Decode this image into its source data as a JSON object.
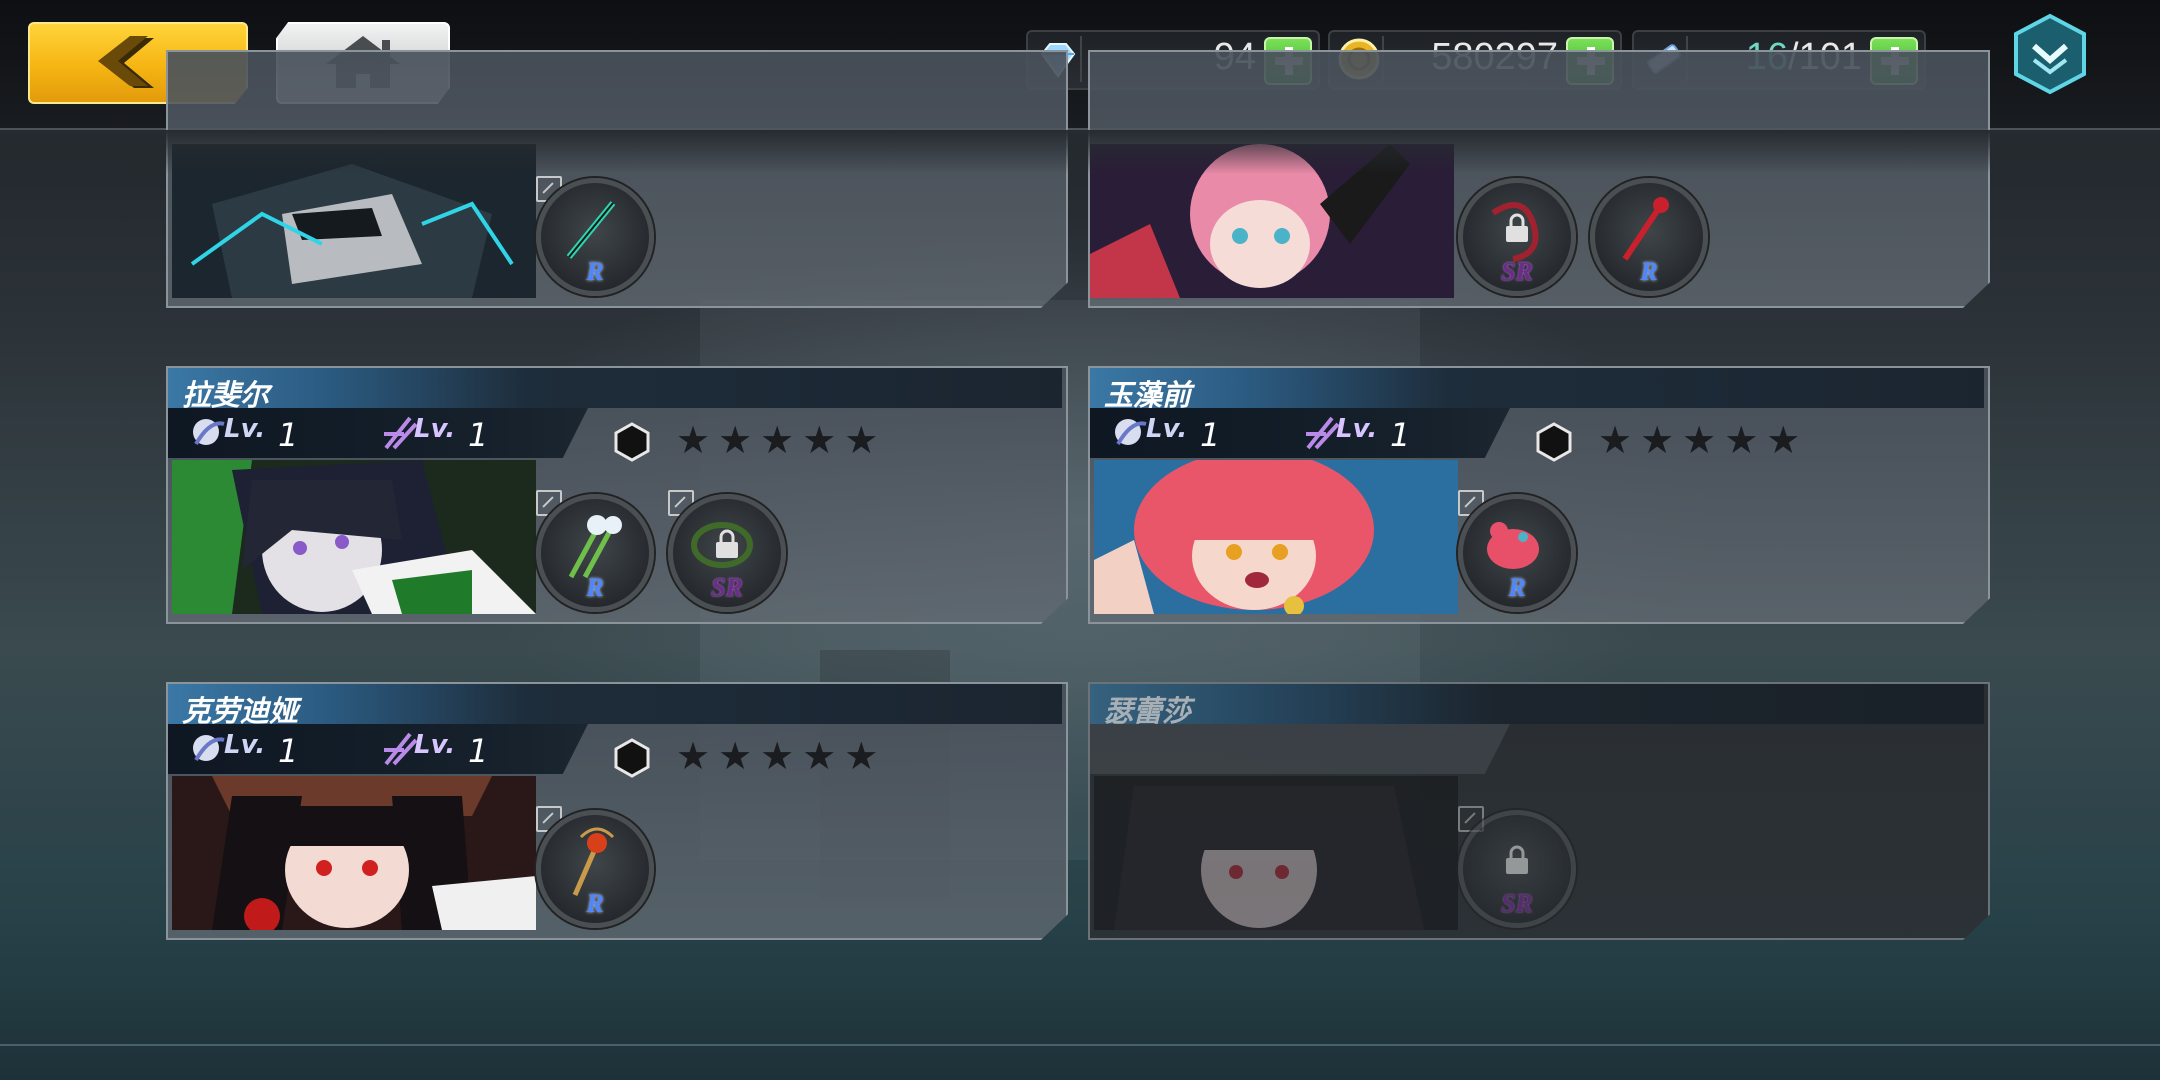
{
  "header": {
    "back_label": "",
    "home_label": "",
    "resources": [
      {
        "icon": "diamond-icon",
        "value": "94"
      },
      {
        "icon": "gold-coin-icon",
        "value": "580297"
      },
      {
        "icon": "stamina-ticket-icon",
        "current": "16",
        "max": "/101"
      }
    ]
  },
  "cards": [
    {
      "name": "",
      "level_skill": "",
      "level_weapon": "",
      "stars": "",
      "equipment": [
        {
          "rarity": "R",
          "locked": false
        }
      ]
    },
    {
      "name": "",
      "level_skill": "",
      "level_weapon": "",
      "stars": "",
      "equipment": [
        {
          "rarity": "SR",
          "locked": true
        },
        {
          "rarity": "R",
          "locked": false
        }
      ]
    },
    {
      "name": "拉斐尔",
      "lv_label": "Lv.",
      "level_skill": "1",
      "level_weapon": "1",
      "stars": "★★★★★",
      "equipment": [
        {
          "rarity": "R",
          "locked": false
        },
        {
          "rarity": "SR",
          "locked": true
        }
      ]
    },
    {
      "name": "玉藻前",
      "lv_label": "Lv.",
      "level_skill": "1",
      "level_weapon": "1",
      "stars": "★★★★★",
      "equipment": [
        {
          "rarity": "R",
          "locked": false
        }
      ]
    },
    {
      "name": "克劳迪娅",
      "lv_label": "Lv.",
      "level_skill": "1",
      "level_weapon": "1",
      "stars": "★★★★★",
      "equipment": [
        {
          "rarity": "R",
          "locked": false
        }
      ]
    },
    {
      "name": "瑟蕾莎",
      "locked_card": true,
      "equipment": [
        {
          "rarity": "SR",
          "locked": true
        }
      ]
    }
  ],
  "colors": {
    "back_button": "#f5b512",
    "plus_button": "#2fa423",
    "rarity_r": "#4d86ff",
    "rarity_sr": "#6b2d86",
    "stamina_current": "#6fd8c2"
  }
}
